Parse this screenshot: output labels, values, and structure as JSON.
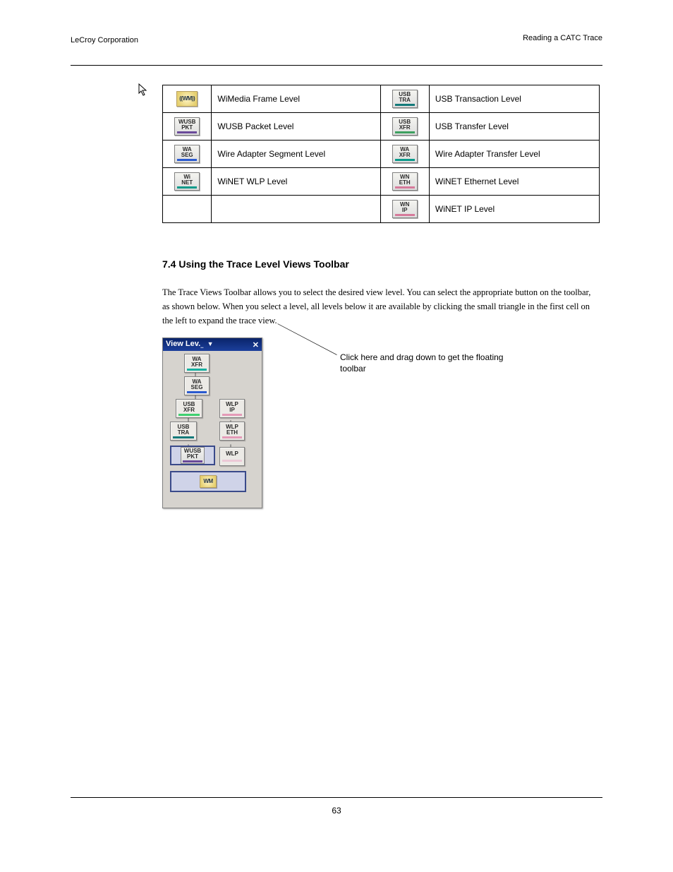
{
  "header": {
    "left": "LeCroy Corporation",
    "right": "Reading a CATC Trace"
  },
  "footer": {
    "center": "63"
  },
  "table": {
    "rows": [
      {
        "left_icon": "WM",
        "left_icon_type": "wm",
        "left_desc": "WiMedia Frame Level",
        "right_icon": "USB\nTRA",
        "right_icon_type": "dkteal",
        "right_desc": "USB Transaction Level"
      },
      {
        "left_icon": "WUSB\nPKT",
        "left_icon_type": "purple",
        "left_desc": "WUSB Packet Level",
        "right_icon": "USB\nXFR",
        "right_icon_type": "green",
        "right_desc": "USB Transfer Level"
      },
      {
        "left_icon": "WA\nSEG",
        "left_icon_type": "blue",
        "left_desc": "Wire Adapter Segment Level",
        "right_icon": "WA\nXFR",
        "right_icon_type": "teal",
        "right_desc": "Wire Adapter Transfer Level"
      },
      {
        "left_icon": "Wi\nNET",
        "left_icon_type": "teal",
        "left_desc": "WiNET WLP Level",
        "right_icon": "WN\nETH",
        "right_icon_type": "pink",
        "right_desc": "WiNET Ethernet Level"
      },
      {
        "left_icon": "",
        "left_icon_type": "",
        "left_desc": "",
        "right_icon": "WN\nIP",
        "right_icon_type": "pink",
        "right_desc": "WiNET IP Level"
      }
    ]
  },
  "section": {
    "heading": "7.4    Using the Trace Level Views Toolbar",
    "para": "The Trace Views Toolbar allows you to select the desired view level. You can select the appropriate button on the toolbar, as shown below. When you select a level, all levels below it are available by clicking the small triangle in the first cell on the left to expand the trace view."
  },
  "vl": {
    "title": "View Lev.",
    "btn_wa_xfr": "WA\nXFR",
    "btn_wa_seg": "WA\nSEG",
    "btn_usb_xfr": "USB\nXFR",
    "btn_wlp_ip": "WLP\nIP",
    "btn_usb_tra": "USB\nTRA",
    "btn_wlp_eth": "WLP\nETH",
    "btn_wusb_pkt": "WUSB\nPKT",
    "btn_wlp": "WLP",
    "btn_wm": "WM"
  },
  "callout": "Click here and drag down to get the floating toolbar"
}
